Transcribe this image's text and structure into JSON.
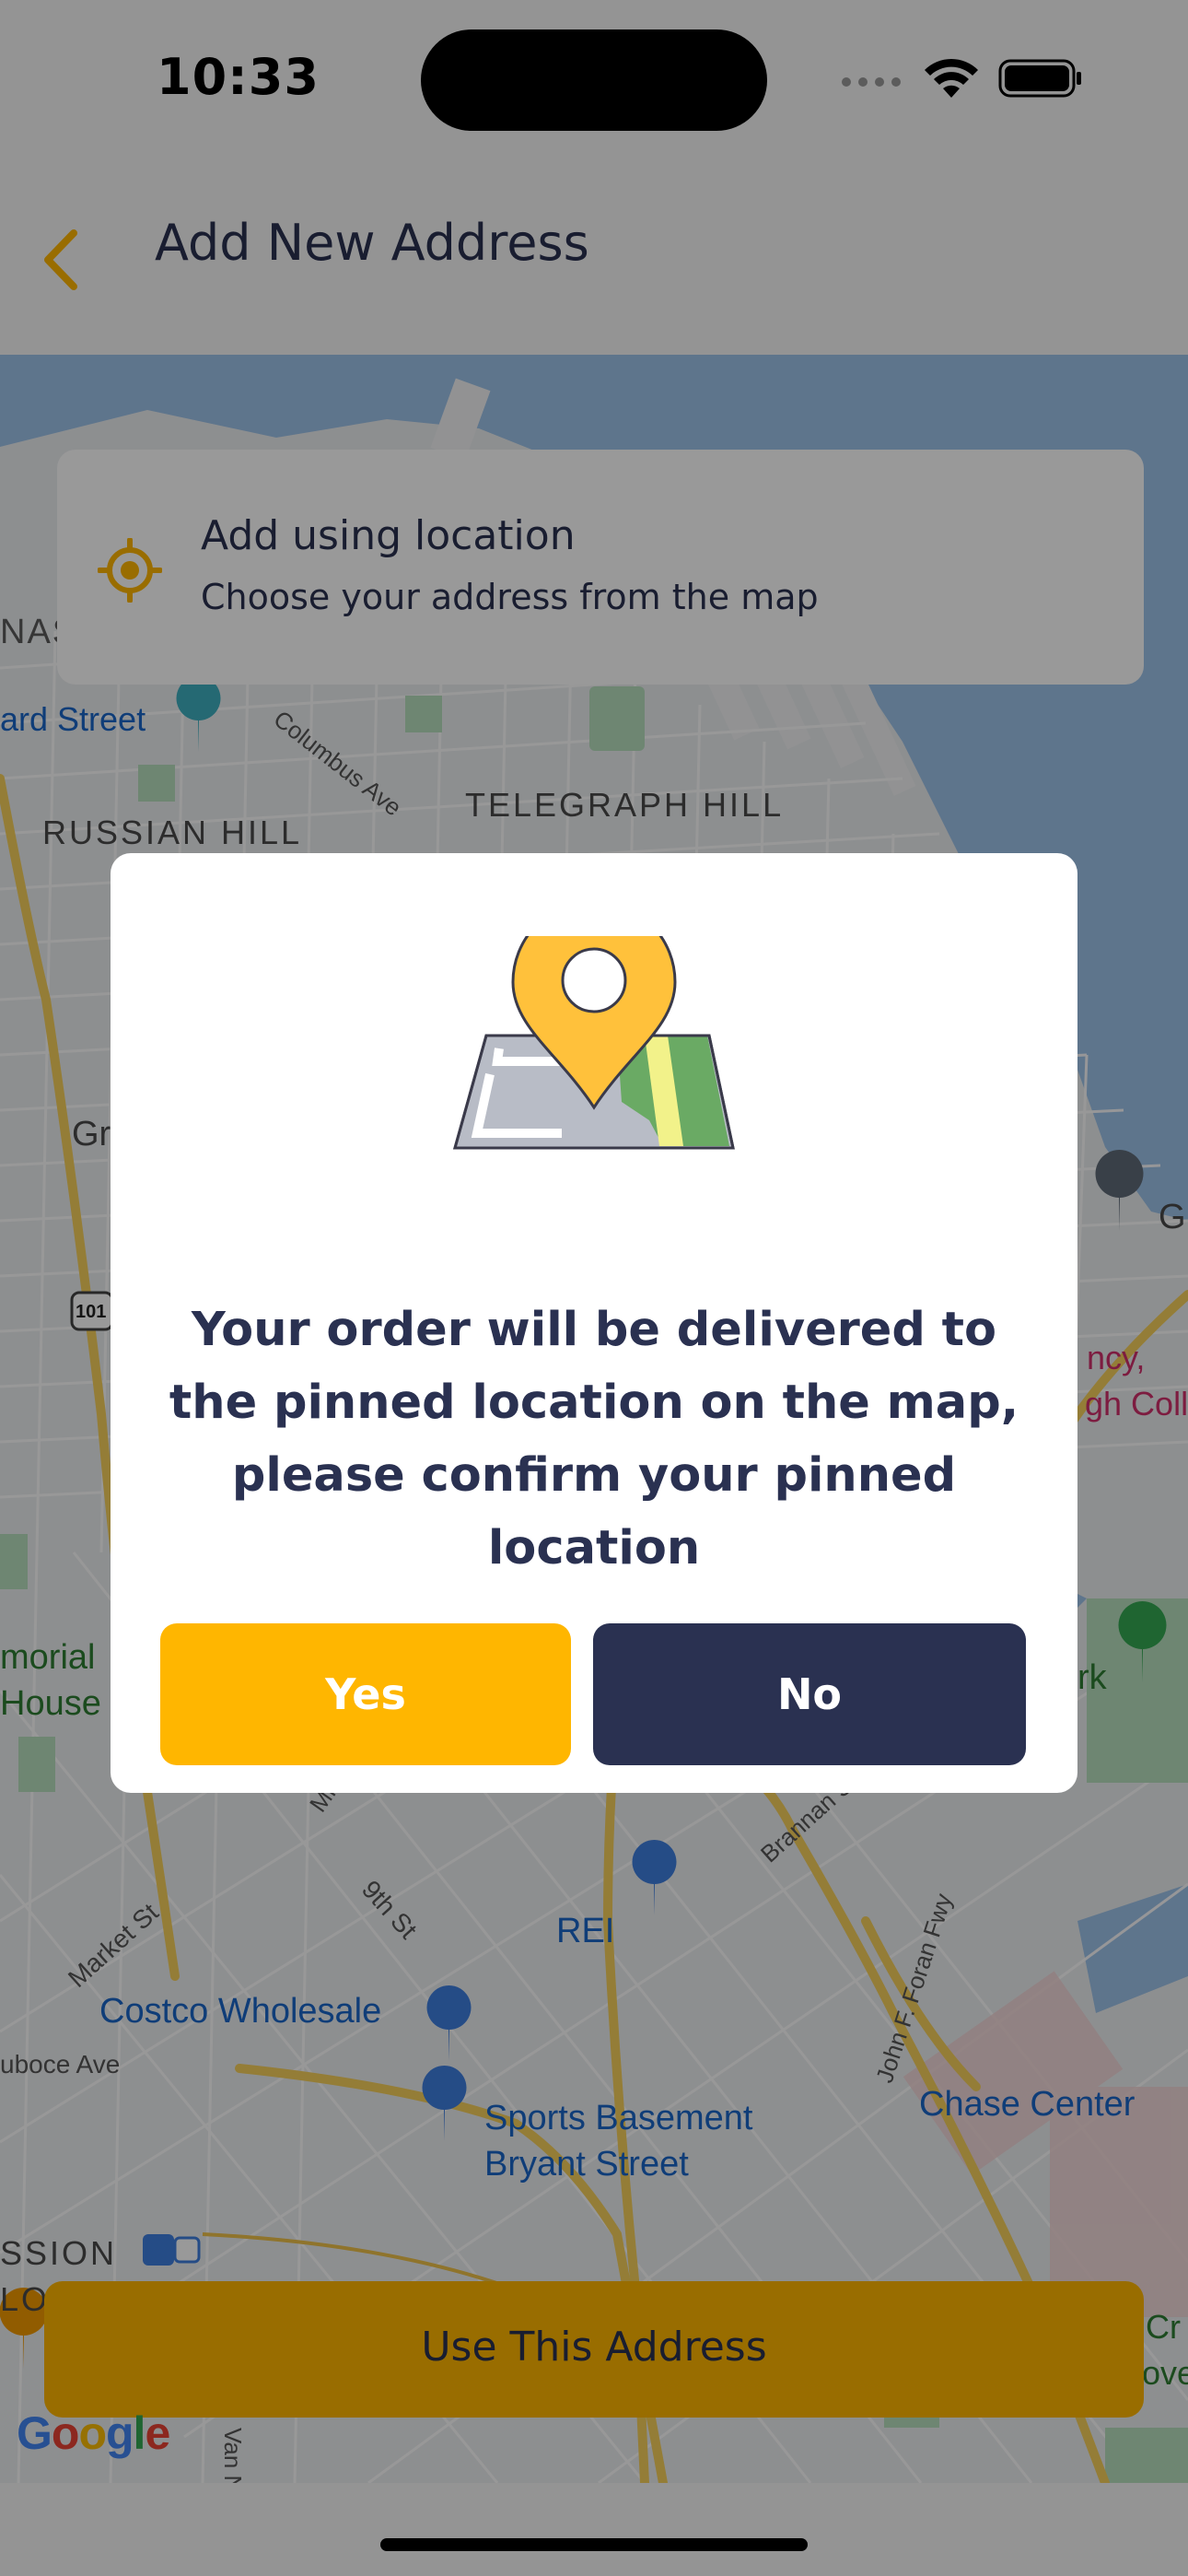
{
  "status_bar": {
    "time": "10:33"
  },
  "header": {
    "title": "Add New Address"
  },
  "location_card": {
    "title": "Add using location",
    "subtitle": "Choose your address from the map"
  },
  "map": {
    "labels": {
      "telegraph_hill": "TELEGRAPH HILL",
      "russian_hill": "RUSSIAN HILL",
      "columbus_ave": "Columbus Ave",
      "ard_street": "ard Street",
      "nas": "NAS",
      "costco": "Costco Wholesale",
      "rei": "REI",
      "sports_basement_line1": "Sports Basement",
      "sports_basement_line2": "Bryant Street",
      "chase_center": "Chase Center",
      "market_st": "Market St",
      "ninth_st": "9th St",
      "brannan_st": "Brannan St",
      "john_f_foran": "John F. Foran Fwy",
      "duboce_ave": "uboce Ave",
      "memorial_line1": "morial",
      "memorial_line2": "House",
      "mission": "SSION",
      "mission2": "LO",
      "cy_line1": "ncy,",
      "cy_line2": "gh Coll",
      "rk": "rk",
      "gr": "Gr",
      "g_right": "G",
      "route_101": "101",
      "van": "Van N",
      "miss": "Miss",
      "cr_line1": "Cr",
      "cr_line2": "ove"
    },
    "google_letters": [
      "G",
      "o",
      "o",
      "g",
      "l",
      "e"
    ]
  },
  "dialog": {
    "message": "Your order will be delivered to the pinned location on the map, please confirm your pinned location",
    "yes_label": "Yes",
    "no_label": "No"
  },
  "use_address_button": "Use This Address",
  "colors": {
    "accent": "#ffb600",
    "navy": "#2a3151",
    "water": "#9dc3ea",
    "park": "#a8dab5"
  }
}
